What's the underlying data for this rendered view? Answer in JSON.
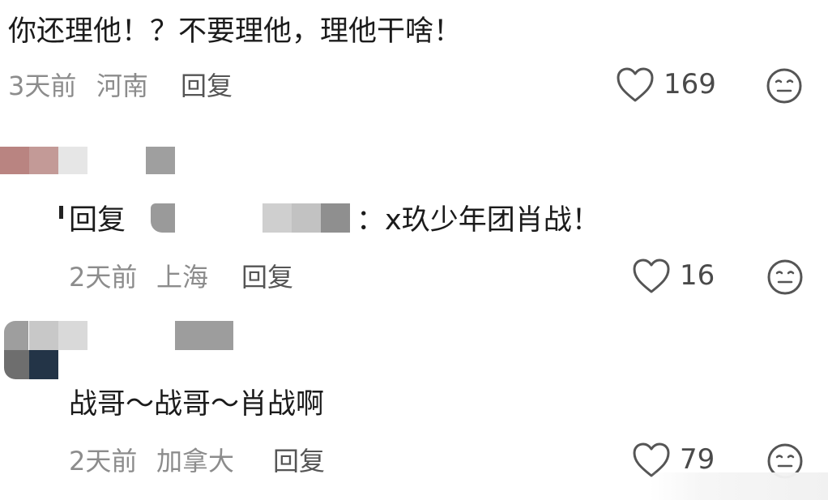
{
  "comments": [
    {
      "text": "你还理他！？不要理他，理他干啥！",
      "time": "3天前",
      "location": "河南",
      "reply_label": "回复",
      "likes": "169"
    },
    {
      "reply_prefix": "回复",
      "text": "：x玖少年团肖战！",
      "time": "2天前",
      "location": "上海",
      "reply_label": "回复",
      "likes": "16"
    },
    {
      "text": "战哥～战哥～肖战啊",
      "time": "2天前",
      "location": "加拿大",
      "reply_label": "回复",
      "likes": "79"
    }
  ],
  "icons": {
    "like": "heart-outline-icon",
    "dislike": "neutral-face-icon"
  },
  "colors": {
    "text": "#1b1b1b",
    "meta": "#8c8c8c",
    "icon": "#555555"
  }
}
